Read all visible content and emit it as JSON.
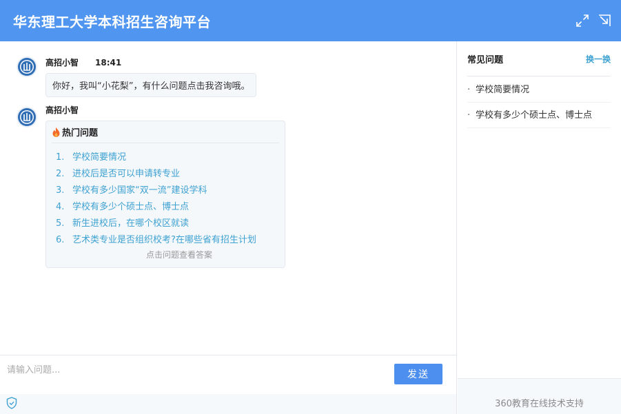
{
  "header": {
    "title": "华东理工大学本科招生咨询平台",
    "icons": [
      "expand-icon",
      "minimize-icon"
    ],
    "color": "#5095ef"
  },
  "messages": [
    {
      "sender": "高招小智",
      "time": "18:41",
      "text": "你好，我叫“小花梨”，有什么问题点击我咨询哦。"
    },
    {
      "sender": "高招小智",
      "hot_title": "热门问题",
      "hot_items": [
        {
          "num": "1.",
          "text": "学校简要情况"
        },
        {
          "num": "2.",
          "text": "进校后是否可以申请转专业"
        },
        {
          "num": "3.",
          "text": "学校有多少国家“双一流”建设学科"
        },
        {
          "num": "4.",
          "text": "学校有多少个硕士点、博士点"
        },
        {
          "num": "5.",
          "text": "新生进校后，在哪个校区就读"
        },
        {
          "num": "6.",
          "text": "艺术类专业是否组织校考?在哪些省有招生计划"
        }
      ],
      "hint": "点击问题查看答案"
    }
  ],
  "input": {
    "placeholder": "请输入问题...",
    "value": "",
    "send_label": "发送"
  },
  "sidebar": {
    "title": "常见问题",
    "refresh_label": "换一换",
    "items": [
      {
        "dot": "·",
        "text": "学校简要情况"
      },
      {
        "dot": "·",
        "text": "学校有多少个硕士点、博士点"
      }
    ],
    "footer": "360教育在线技术支持"
  },
  "colors": {
    "accent": "#4d8fee",
    "link": "#3da1d1"
  }
}
